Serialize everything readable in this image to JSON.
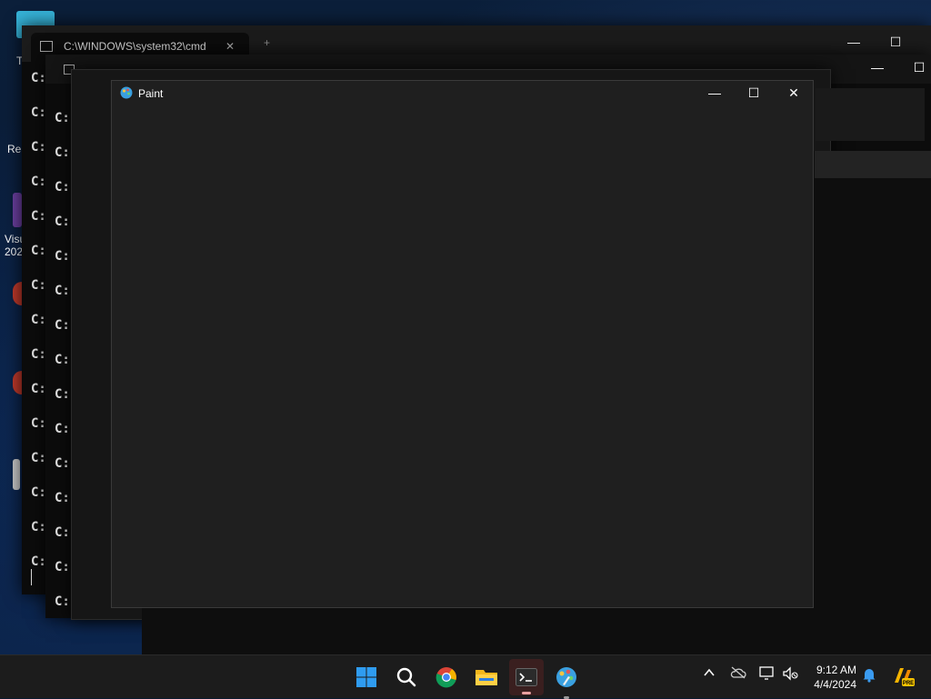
{
  "desktop": {
    "icons": [
      {
        "label": "T"
      },
      {
        "label": "Re"
      },
      {
        "label": "Visu"
      },
      {
        "label": "202"
      }
    ]
  },
  "cmd_back": {
    "tab_title": "C:\\WINDOWS\\system32\\cmd",
    "tab_close": "✕",
    "new_tab": "+",
    "lines": [
      "C:",
      "C:",
      "C:",
      "C:",
      "C:",
      "C:",
      "C:",
      "C:",
      "C:",
      "C:",
      "C:",
      "C:",
      "C:",
      "C:",
      "C:"
    ]
  },
  "cmd_front": {
    "lines": [
      "C:",
      "C:",
      "C:",
      "C:",
      "C:",
      "C:",
      "C:",
      "C:",
      "C:",
      "C:",
      "C:",
      "C:",
      "C:",
      "C:",
      "C:"
    ]
  },
  "paint": {
    "title": "Paint",
    "minimize": "—",
    "maximize": "☐",
    "close": "✕"
  },
  "taskbar": {
    "time": "9:12 AM",
    "date": "4/4/2024",
    "icons": [
      "windows-start-icon",
      "search-icon",
      "chrome-icon",
      "file-explorer-icon",
      "terminal-icon",
      "paint-icon"
    ],
    "tray": [
      "chevron-up-icon",
      "onedrive-icon",
      "network-icon",
      "volume-muted-icon",
      "notification-bell-icon",
      "copilot-icon"
    ]
  },
  "colors": {
    "accent": "#0078d4",
    "paint_bg": "#1f1f1f",
    "taskbar": "#1c1c1c"
  }
}
